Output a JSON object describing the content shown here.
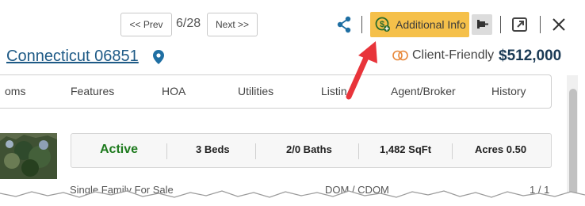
{
  "nav": {
    "prev_label": "<< Prev",
    "counter": "6/28",
    "next_label": "Next >>"
  },
  "actions": {
    "additional_info_label": "Additional Info"
  },
  "listing": {
    "address_visible": "Connecticut 06851",
    "client_friendly_label": "Client-Friendly",
    "price": "$512,000"
  },
  "tabs": [
    "oms",
    "Features",
    "HOA",
    "Utilities",
    "Listin",
    "Agent/Broker",
    "History"
  ],
  "summary": {
    "status": "Active",
    "beds": "3 Beds",
    "baths": "2/0 Baths",
    "sqft": "1,482 SqFt",
    "acres": "Acres 0.50"
  },
  "bottom": {
    "left_text": "Single Family For Sale",
    "mid_text": "DOM / CDOM",
    "right_text": "1 / 1"
  },
  "colors": {
    "accent_yellow": "#f5c04a",
    "link_blue": "#1e5a86",
    "active_green": "#1d7a1d",
    "arrow_red": "#e8343a"
  }
}
